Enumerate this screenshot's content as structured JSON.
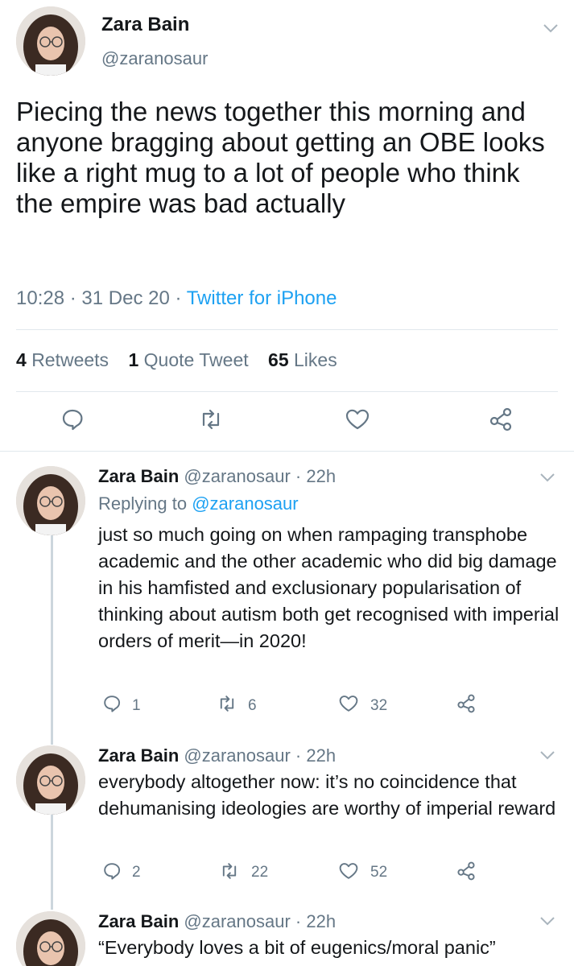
{
  "main_tweet": {
    "name": "Zara Bain",
    "handle": "@zaranosaur",
    "text": "Piecing the news together this morning and anyone bragging about getting an OBE looks like a right mug to a lot of people who think the empire was bad actually",
    "time": "10:28",
    "date": "31 Dec 20",
    "source": "Twitter for iPhone",
    "separator": "·",
    "stats": {
      "retweets_count": "4",
      "retweets_label": "Retweets",
      "quotes_count": "1",
      "quotes_label": "Quote Tweet",
      "likes_count": "65",
      "likes_label": "Likes"
    }
  },
  "replies": [
    {
      "name": "Zara Bain",
      "handle": "@zaranosaur",
      "age": "22h",
      "replying_prefix": "Replying to",
      "replying_to": "@zaranosaur",
      "text": "just so much going on when rampaging transphobe academic and the other academic who did big damage in his hamfisted and exclusionary popularisation of thinking about autism both get recognised with imperial orders of merit—in 2020!",
      "replies": "1",
      "retweets": "6",
      "likes": "32"
    },
    {
      "name": "Zara Bain",
      "handle": "@zaranosaur",
      "age": "22h",
      "text": "everybody altogether now: it’s no coincidence that dehumanising ideologies are worthy of imperial reward",
      "replies": "2",
      "retweets": "22",
      "likes": "52"
    },
    {
      "name": "Zara Bain",
      "handle": "@zaranosaur",
      "age": "22h",
      "text": "“Everybody loves a bit of eugenics/moral panic”"
    }
  ],
  "colors": {
    "link": "#1da1f2",
    "muted": "#657786",
    "text": "#14171a",
    "divider": "#e1e8ed"
  },
  "icons": [
    "reply-icon",
    "retweet-icon",
    "like-icon",
    "share-icon",
    "chevron-down-icon",
    "avatar"
  ]
}
